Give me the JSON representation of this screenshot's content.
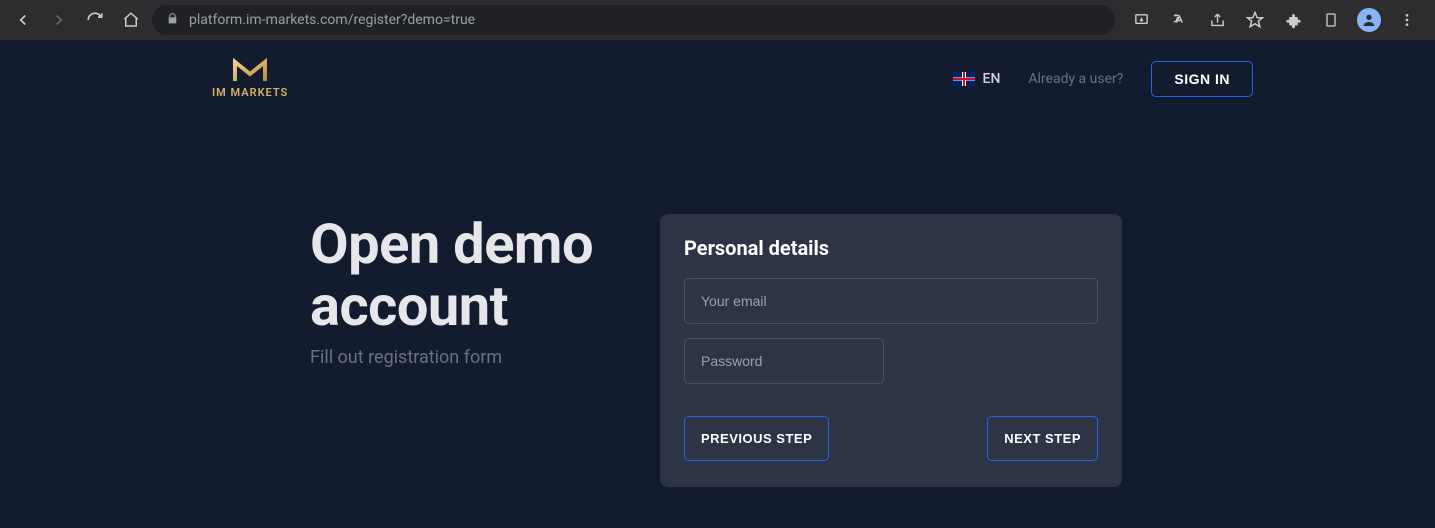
{
  "browser": {
    "url_host": "platform.im-markets.com",
    "url_path": "/register?demo=true"
  },
  "header": {
    "logo_text": "IM MARKETS",
    "lang_label": "EN",
    "already_user": "Already a user?",
    "signin_label": "SIGN IN"
  },
  "main": {
    "title": "Open demo account",
    "subtitle": "Fill out registration form"
  },
  "form": {
    "section_title": "Personal details",
    "email_placeholder": "Your email",
    "password_placeholder": "Password",
    "prev_label": "PREVIOUS STEP",
    "next_label": "NEXT STEP"
  }
}
